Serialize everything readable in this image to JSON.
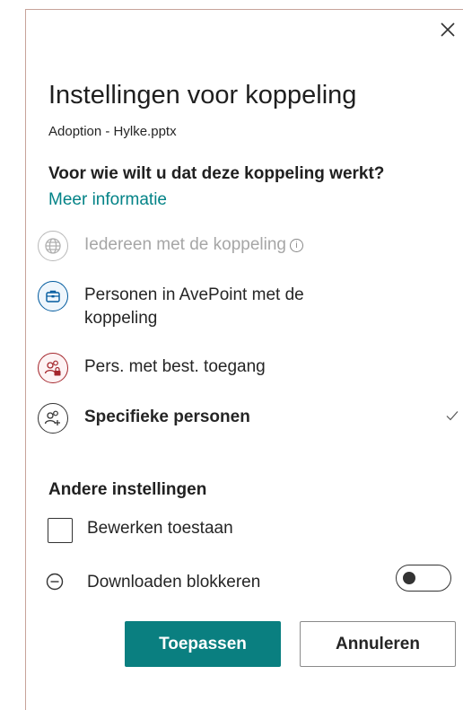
{
  "dialog": {
    "title": "Instellingen voor koppeling",
    "file_name": "Adoption - Hylke.pptx",
    "question": "Voor wie wilt u dat deze koppeling werkt?",
    "more_info_link": "Meer informatie"
  },
  "options": [
    {
      "label": "Iedereen met de koppeling",
      "icon": "globe-icon",
      "state": "disabled",
      "info_glyph": "i"
    },
    {
      "label": "Personen in AvePoint met de koppeling",
      "icon": "briefcase-icon",
      "state": "enabled"
    },
    {
      "label": "Pers. met best. toegang",
      "icon": "people-lock-icon",
      "state": "enabled"
    },
    {
      "label": "Specifieke personen",
      "icon": "people-add-icon",
      "state": "selected"
    }
  ],
  "other_settings": {
    "title": "Andere instellingen",
    "allow_edit_label": "Bewerken toestaan",
    "allow_edit_checked": false,
    "block_download_label": "Downloaden blokkeren",
    "block_download_on": false
  },
  "buttons": {
    "apply": "Toepassen",
    "cancel": "Annuleren"
  },
  "colors": {
    "accent": "#038387",
    "primary_button": "#0a7f80",
    "frame": "#c7a39a",
    "blue_icon": "#005a9e",
    "red_icon": "#a4262c"
  }
}
